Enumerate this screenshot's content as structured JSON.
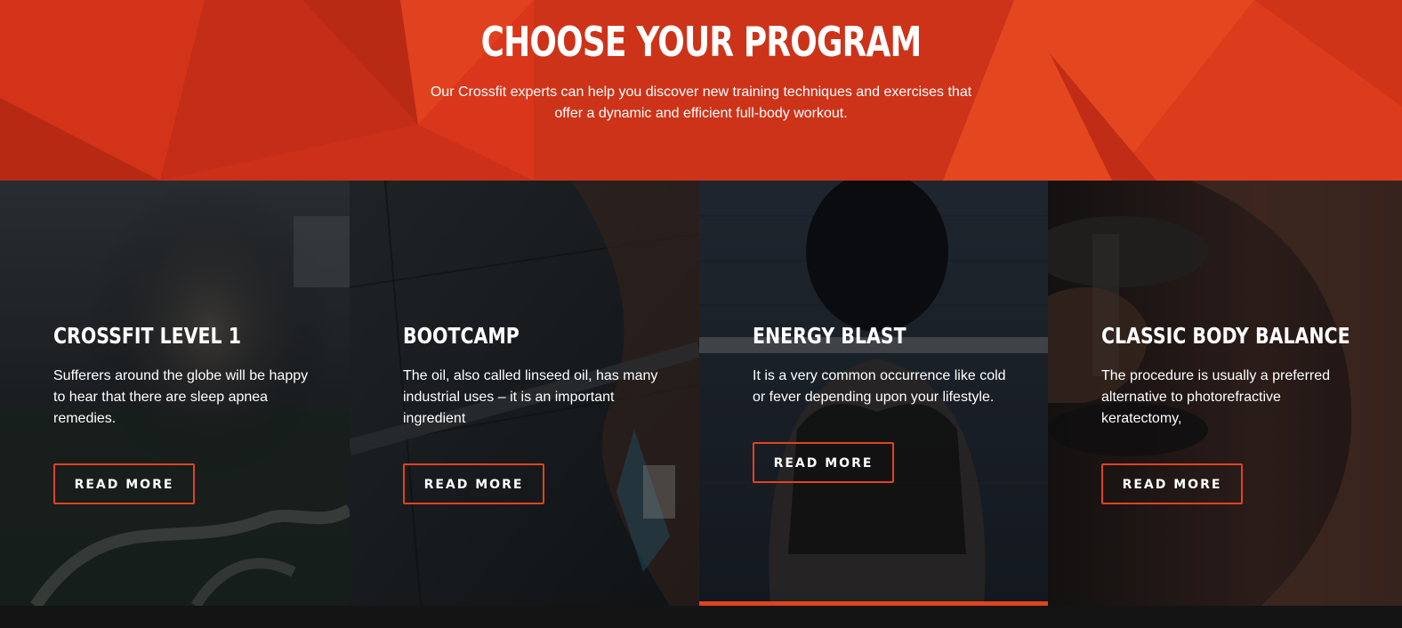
{
  "hero": {
    "title": "CHOOSE YOUR PROGRAM",
    "subtitle": "Our Crossfit experts can help you discover new training techniques and exercises that offer a dynamic and efficient full-body workout."
  },
  "colors": {
    "accent": "#e2421f",
    "hero_background": "#d9361c",
    "page_background": "#141414",
    "text": "#ffffff"
  },
  "programs": [
    {
      "title": "CROSSFIT LEVEL 1",
      "description": "Sufferers around the globe will be happy to hear that there are sleep apnea remedies.",
      "button_label": "READ MORE",
      "image": "battle-ropes-photo",
      "active": false
    },
    {
      "title": "BOOTCAMP",
      "description": "The oil, also called linseed oil, has many industrial uses – it is an important ingredient",
      "button_label": "READ MORE",
      "image": "barbell-lift-photo",
      "active": false
    },
    {
      "title": "ENERGY BLAST",
      "description": "It is a very common occurrence like cold or fever depending upon your lifestyle.",
      "button_label": "READ MORE",
      "image": "tattooed-back-squat-photo",
      "active": true
    },
    {
      "title": "CLASSIC BODY BALANCE",
      "description": "The procedure is usually a preferred alternative to photorefractive keratectomy,",
      "button_label": "READ MORE",
      "image": "dumbbell-curl-photo",
      "active": false
    }
  ]
}
